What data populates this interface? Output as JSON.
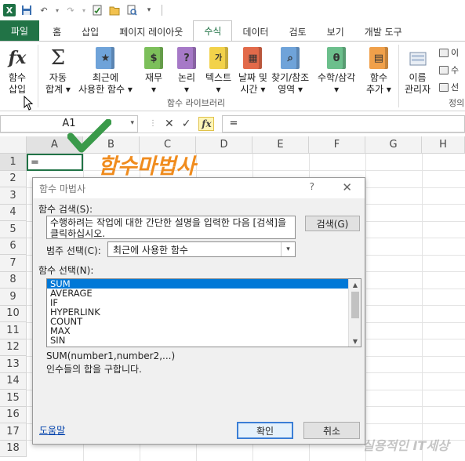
{
  "qat": {
    "app_icon_text": "X",
    "undo_icon": "undo-icon",
    "redo_icon": "redo-icon"
  },
  "tabs": [
    {
      "label": "파일"
    },
    {
      "label": "홈"
    },
    {
      "label": "삽입"
    },
    {
      "label": "페이지 레이아웃"
    },
    {
      "label": "수식"
    },
    {
      "label": "데이터"
    },
    {
      "label": "검토"
    },
    {
      "label": "보기"
    },
    {
      "label": "개발 도구"
    }
  ],
  "ribbon": {
    "insert_function": {
      "line1": "함수",
      "line2": "삽입"
    },
    "autosum": {
      "line1": "자동",
      "line2": "합계 ▾"
    },
    "recent": {
      "line1": "최근에",
      "line2": "사용한 함수 ▾"
    },
    "financial": {
      "line1": "재무",
      "line2": "▾"
    },
    "logical": {
      "line1": "논리",
      "line2": "▾"
    },
    "text": {
      "line1": "텍스트",
      "line2": "▾"
    },
    "datetime": {
      "line1": "날짜 및",
      "line2": "시간 ▾"
    },
    "lookup": {
      "line1": "찾기/참조",
      "line2": "영역 ▾"
    },
    "math": {
      "line1": "수학/삼각",
      "line2": "▾"
    },
    "more": {
      "line1": "함수",
      "line2": "추가 ▾"
    },
    "name_manager": {
      "line1": "이름",
      "line2": "관리자"
    },
    "group_label": "함수 라이브러리",
    "side_items": [
      "이",
      "수",
      "선"
    ],
    "group_label_right": "정의"
  },
  "formula_bar": {
    "name_box": "A1",
    "content": "="
  },
  "sheet": {
    "columns": [
      "A",
      "B",
      "C",
      "D",
      "E",
      "F",
      "G",
      "H"
    ],
    "rows": [
      "1",
      "2",
      "3",
      "4",
      "5",
      "6",
      "7",
      "8",
      "9",
      "10",
      "11",
      "12",
      "13",
      "14",
      "15",
      "16",
      "17",
      "18"
    ],
    "a1_value": "="
  },
  "overlay": {
    "title": "함수마법사",
    "watermark": "실용적인 IT세상"
  },
  "dialog": {
    "title": "함수 마법사",
    "help_glyph": "?",
    "close_glyph": "✕",
    "search_label": "함수 검색(S):",
    "search_text": "수행하려는 작업에 대한 간단한 설명을 입력한 다음 [검색]을 클릭하십시오.",
    "search_button": "검색(G)",
    "category_label": "범주 선택(C):",
    "category_value": "최근에 사용한 함수",
    "function_label": "함수 선택(N):",
    "functions": [
      "SUM",
      "AVERAGE",
      "IF",
      "HYPERLINK",
      "COUNT",
      "MAX",
      "SIN"
    ],
    "selected_function": "SUM",
    "syntax": "SUM(number1,number2,...)",
    "description": "인수들의 합을 구합니다.",
    "help_link": "도움말",
    "ok_button": "확인",
    "cancel_button": "취소"
  },
  "colors": {
    "excel_green": "#217346",
    "accent_orange": "#f08c1e",
    "selection_blue": "#0078d7"
  }
}
